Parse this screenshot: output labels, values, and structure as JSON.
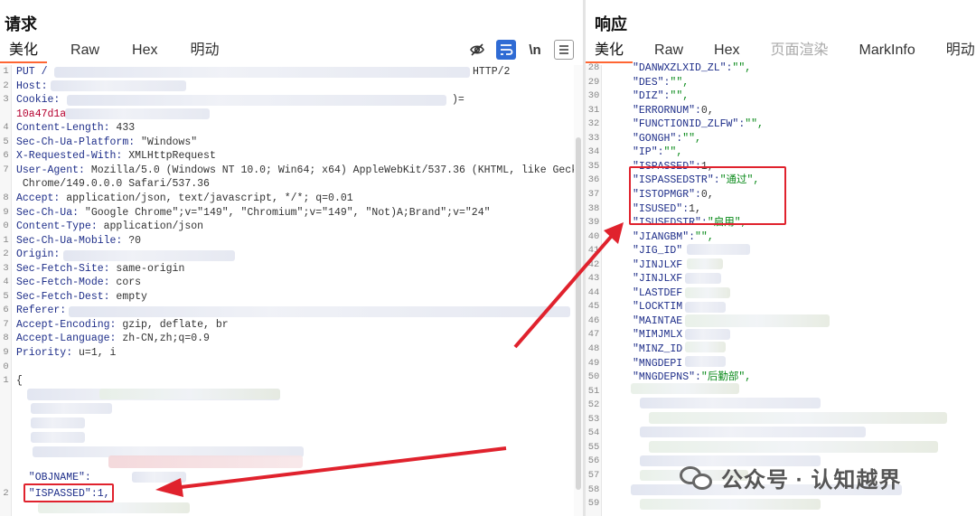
{
  "request": {
    "title": "请求",
    "tabs": [
      "美化",
      "Raw",
      "Hex",
      "明动"
    ],
    "active_tab": "美化",
    "lines": [
      {
        "n": "1",
        "parts": [
          [
            "k",
            "PUT /"
          ],
          [
            "v",
            ""
          ]
        ],
        "tail": "HTTP/2"
      },
      {
        "n": "2",
        "parts": [
          [
            "k",
            "Host:"
          ]
        ]
      },
      {
        "n": "3",
        "parts": [
          [
            "k",
            "Cookie:"
          ]
        ],
        "tail2": ")="
      },
      {
        "n": "",
        "parts": [
          [
            "red",
            "10a47d1a"
          ]
        ]
      },
      {
        "n": "4",
        "parts": [
          [
            "k",
            "Content-Length:"
          ],
          [
            "v",
            " 433"
          ]
        ]
      },
      {
        "n": "5",
        "parts": [
          [
            "k",
            "Sec-Ch-Ua-Platform:"
          ],
          [
            "v",
            " \"Windows\""
          ]
        ]
      },
      {
        "n": "6",
        "parts": [
          [
            "k",
            "X-Requested-With:"
          ],
          [
            "v",
            " XMLHttpRequest"
          ]
        ]
      },
      {
        "n": "7",
        "parts": [
          [
            "k",
            "User-Agent:"
          ],
          [
            "v",
            " Mozilla/5.0 (Windows NT 10.0; Win64; x64) AppleWebKit/537.36 (KHTML, like Gecko)"
          ]
        ]
      },
      {
        "n": "",
        "parts": [
          [
            "v",
            " Chrome/149.0.0.0 Safari/537.36"
          ]
        ]
      },
      {
        "n": "8",
        "parts": [
          [
            "k",
            "Accept:"
          ],
          [
            "v",
            " application/json, text/javascript, */*; q=0.01"
          ]
        ]
      },
      {
        "n": "9",
        "parts": [
          [
            "k",
            "Sec-Ch-Ua:"
          ],
          [
            "v",
            " \"Google Chrome\";v=\"149\", \"Chromium\";v=\"149\", \"Not)A;Brand\";v=\"24\""
          ]
        ]
      },
      {
        "n": "0",
        "parts": [
          [
            "k",
            "Content-Type:"
          ],
          [
            "v",
            " application/json"
          ]
        ]
      },
      {
        "n": "1",
        "parts": [
          [
            "k",
            "Sec-Ch-Ua-Mobile:"
          ],
          [
            "v",
            " ?0"
          ]
        ]
      },
      {
        "n": "2",
        "parts": [
          [
            "k",
            "Origin:"
          ]
        ]
      },
      {
        "n": "3",
        "parts": [
          [
            "k",
            "Sec-Fetch-Site:"
          ],
          [
            "v",
            " same-origin"
          ]
        ]
      },
      {
        "n": "4",
        "parts": [
          [
            "k",
            "Sec-Fetch-Mode:"
          ],
          [
            "v",
            " cors"
          ]
        ]
      },
      {
        "n": "5",
        "parts": [
          [
            "k",
            "Sec-Fetch-Dest:"
          ],
          [
            "v",
            " empty"
          ]
        ]
      },
      {
        "n": "6",
        "parts": [
          [
            "k",
            "Referer:"
          ]
        ]
      },
      {
        "n": "7",
        "parts": [
          [
            "k",
            "Accept-Encoding:"
          ],
          [
            "v",
            " gzip, deflate, br"
          ]
        ]
      },
      {
        "n": "8",
        "parts": [
          [
            "k",
            "Accept-Language:"
          ],
          [
            "v",
            " zh-CN,zh;q=0.9"
          ]
        ]
      },
      {
        "n": "9",
        "parts": [
          [
            "k",
            "Priority:"
          ],
          [
            "v",
            " u=1, i"
          ]
        ]
      },
      {
        "n": "0",
        "parts": []
      },
      {
        "n": "1",
        "parts": [
          [
            "v",
            "{"
          ]
        ]
      }
    ],
    "objname_line": "  \"OBJNAME\":",
    "ispassed_line": {
      "n": "2",
      "text": "  \"ISPASSED\":1,"
    }
  },
  "response": {
    "title": "响应",
    "tabs": [
      "美化",
      "Raw",
      "Hex",
      "页面渲染",
      "MarkInfo",
      "明动"
    ],
    "active_tab": "美化",
    "disabled_tab": "页面渲染",
    "lines": [
      {
        "n": "28",
        "k": "\"DANWXZLXID_ZL\":",
        "val": "\"\",",
        "vt": "s"
      },
      {
        "n": "29",
        "k": "\"DES\":",
        "val": "\"\",",
        "vt": "s"
      },
      {
        "n": "30",
        "k": "\"DIZ\":",
        "val": "\"\",",
        "vt": "s"
      },
      {
        "n": "31",
        "k": "\"ERRORNUM\":",
        "val": "0,",
        "vt": "v"
      },
      {
        "n": "32",
        "k": "\"FUNCTIONID_ZLFW\":",
        "val": "\"\",",
        "vt": "s"
      },
      {
        "n": "33",
        "k": "\"GONGH\":",
        "val": "\"\",",
        "vt": "s"
      },
      {
        "n": "34",
        "k": "\"IP\":",
        "val": "\"\",",
        "vt": "s"
      },
      {
        "n": "35",
        "k": "\"ISPASSED\":",
        "val": "1,",
        "vt": "v"
      },
      {
        "n": "36",
        "k": "\"ISPASSEDSTR\":",
        "val": "\"通过\",",
        "vt": "s"
      },
      {
        "n": "37",
        "k": "\"ISTOPMGR\":",
        "val": "0,",
        "vt": "v"
      },
      {
        "n": "38",
        "k": "\"ISUSED\":",
        "val": "1,",
        "vt": "v"
      },
      {
        "n": "39",
        "k": "\"ISUSEDSTR\":",
        "val": "\"启用\",",
        "vt": "s"
      },
      {
        "n": "40",
        "k": "\"JIANGBM\":",
        "val": "\"\",",
        "vt": "s"
      },
      {
        "n": "41",
        "k": "\"JIG_ID\"",
        "val": "",
        "vt": "s"
      },
      {
        "n": "42",
        "k": "\"JINJLXF",
        "val": "",
        "vt": "s"
      },
      {
        "n": "43",
        "k": "\"JINJLXF",
        "val": "",
        "vt": "s"
      },
      {
        "n": "44",
        "k": "\"LASTDEF",
        "val": "",
        "vt": "s"
      },
      {
        "n": "45",
        "k": "\"LOCKTIM",
        "val": "",
        "vt": "s"
      },
      {
        "n": "46",
        "k": "\"MAINTAE",
        "val": "",
        "vt": "s"
      },
      {
        "n": "47",
        "k": "\"MIMJMLX",
        "val": "",
        "vt": "s"
      },
      {
        "n": "48",
        "k": "\"MINZ_ID",
        "val": "",
        "vt": "s"
      },
      {
        "n": "49",
        "k": "\"MNGDEPI",
        "val": "",
        "vt": "s"
      },
      {
        "n": "50",
        "k": "\"MNGDEPNS\":",
        "val": "\"后勤部\",",
        "vt": "s"
      },
      {
        "n": "51",
        "k": "",
        "val": "",
        "vt": "s"
      },
      {
        "n": "52",
        "k": "",
        "val": "",
        "vt": "s"
      },
      {
        "n": "53",
        "k": "",
        "val": "",
        "vt": "s"
      },
      {
        "n": "54",
        "k": "",
        "val": "",
        "vt": "s"
      },
      {
        "n": "55",
        "k": "",
        "val": "",
        "vt": "s"
      },
      {
        "n": "56",
        "k": "",
        "val": "",
        "vt": "s"
      },
      {
        "n": "57",
        "k": "",
        "val": "",
        "vt": "s"
      },
      {
        "n": "58",
        "k": "",
        "val": "",
        "vt": "s"
      },
      {
        "n": "59",
        "k": "",
        "val": "",
        "vt": "s"
      }
    ]
  },
  "icons": {
    "hide": "eye-off-icon",
    "wrap": "wrap-lines-icon",
    "newline": "newline-icon",
    "menu": "menu-icon"
  },
  "newline_label": "\\n",
  "colors": {
    "accent": "#ff6633",
    "highlight": "#e0222d",
    "key": "#1f2f8a",
    "string": "#0a8a1a",
    "active_tool": "#2f6bd4"
  },
  "watermark": "公众号 · 认知越界"
}
